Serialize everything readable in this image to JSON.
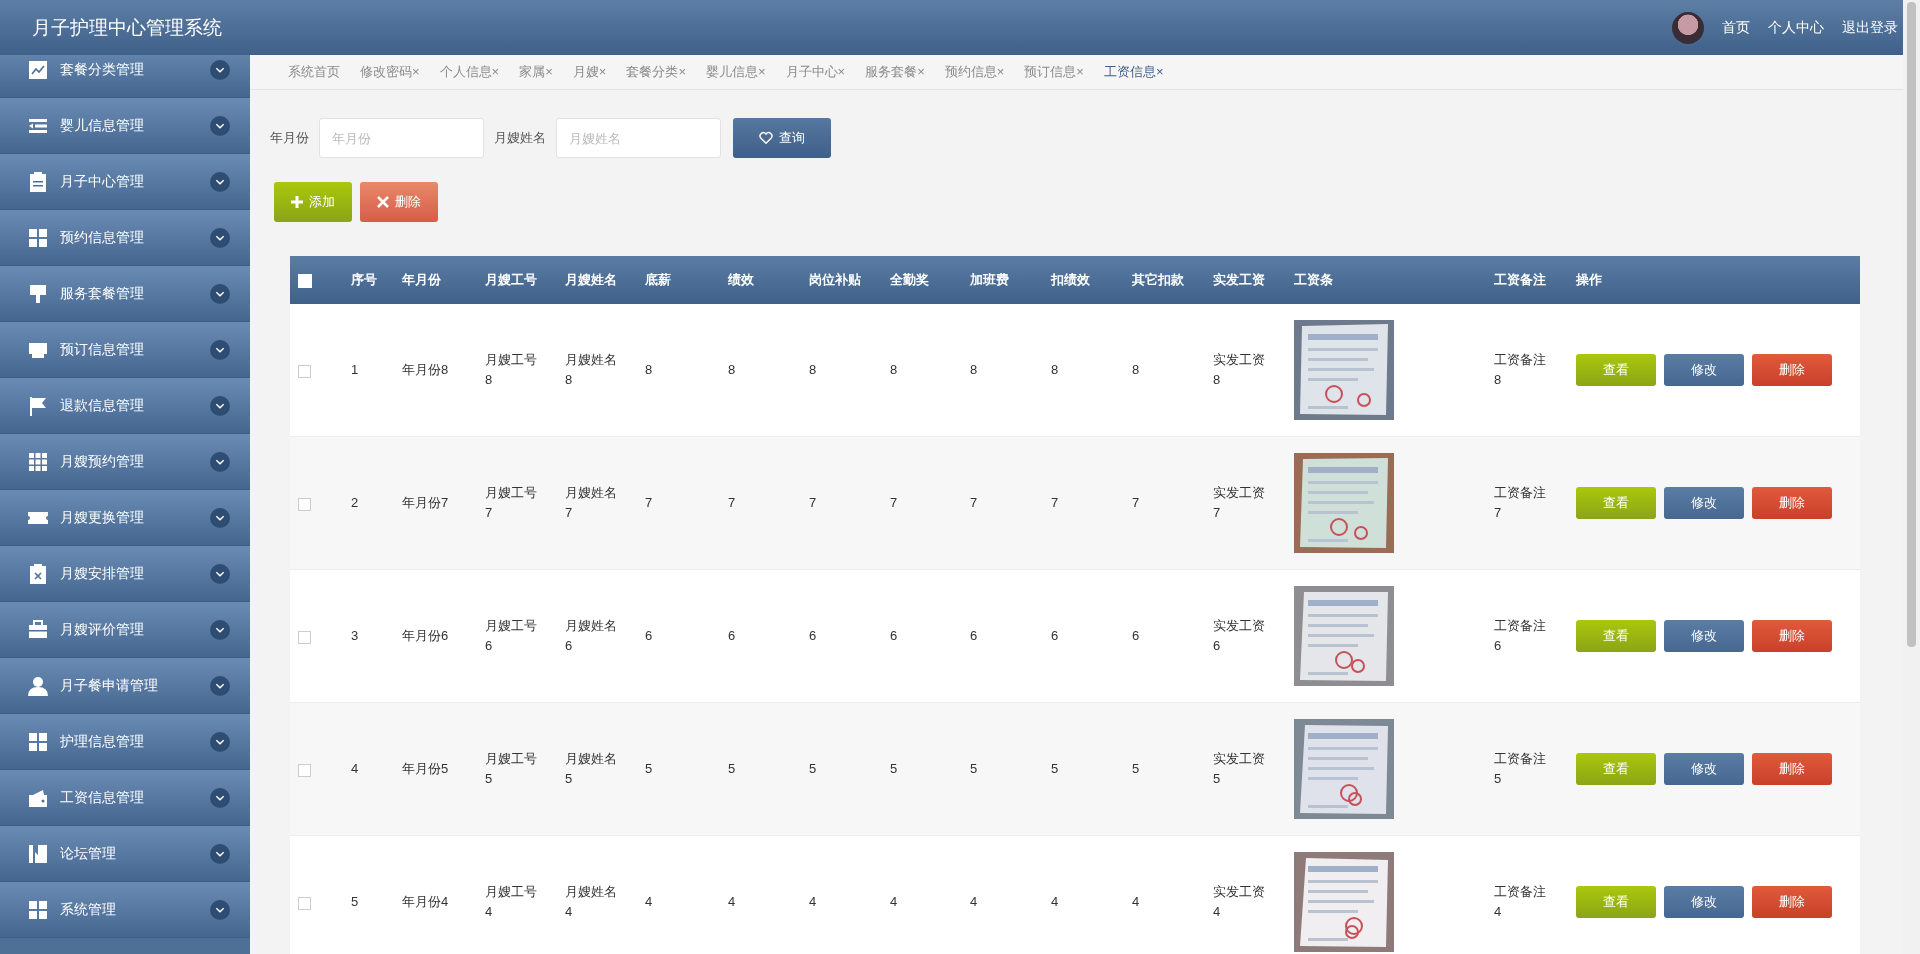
{
  "header": {
    "title": "月子护理中心管理系统",
    "links": [
      "首页",
      "个人中心",
      "退出登录"
    ]
  },
  "sidebar": {
    "items": [
      {
        "label": "套餐分类管理",
        "expanded": false
      },
      {
        "label": "婴儿信息管理",
        "expanded": false
      },
      {
        "label": "月子中心管理",
        "expanded": false
      },
      {
        "label": "预约信息管理",
        "expanded": false
      },
      {
        "label": "服务套餐管理",
        "expanded": false
      },
      {
        "label": "预订信息管理",
        "expanded": false
      },
      {
        "label": "退款信息管理",
        "expanded": false
      },
      {
        "label": "月嫂预约管理",
        "expanded": false
      },
      {
        "label": "月嫂更换管理",
        "expanded": false
      },
      {
        "label": "月嫂安排管理",
        "expanded": false
      },
      {
        "label": "月嫂评价管理",
        "expanded": false
      },
      {
        "label": "月子餐申请管理",
        "expanded": false
      },
      {
        "label": "护理信息管理",
        "expanded": false
      },
      {
        "label": "工资信息管理",
        "expanded": false
      },
      {
        "label": "论坛管理",
        "expanded": false
      },
      {
        "label": "系统管理",
        "expanded": false
      }
    ]
  },
  "tabs": [
    {
      "label": "系统首页",
      "selected": false
    },
    {
      "label": "修改密码",
      "close": "×",
      "selected": false
    },
    {
      "label": "个人信息",
      "close": "×",
      "selected": false
    },
    {
      "label": "家属",
      "close": "×",
      "selected": false
    },
    {
      "label": "月嫂",
      "close": "×",
      "selected": false
    },
    {
      "label": "套餐分类",
      "close": "×",
      "selected": false
    },
    {
      "label": "婴儿信息",
      "close": "×",
      "selected": false
    },
    {
      "label": "月子中心",
      "close": "×",
      "selected": false
    },
    {
      "label": "服务套餐",
      "close": "×",
      "selected": false
    },
    {
      "label": "预约信息",
      "close": "×",
      "selected": false
    },
    {
      "label": "预订信息",
      "close": "×",
      "selected": false
    },
    {
      "label": "工资信息",
      "close": "×",
      "selected": true
    }
  ],
  "search": {
    "fields": [
      {
        "label": "年月份",
        "placeholder": "年月份"
      },
      {
        "label": "月嫂姓名",
        "placeholder": "月嫂姓名"
      }
    ],
    "button": "查询"
  },
  "toolbar": [
    {
      "label": "添加",
      "kind": "add"
    },
    {
      "label": "删除",
      "kind": "delete"
    }
  ],
  "table": {
    "columns": [
      "序号",
      "年月份",
      "月嫂工号",
      "月嫂姓名",
      "底薪",
      "绩效",
      "岗位补贴",
      "全勤奖",
      "加班费",
      "扣绩效",
      "其它扣款",
      "实发工资",
      "工资条",
      "工资备注",
      "操作"
    ],
    "header_checked": false,
    "rows": [
      {
        "checked": false,
        "cells": [
          "1",
          "年月份8",
          "月嫂工号8",
          "月嫂姓名8",
          "8",
          "8",
          "8",
          "8",
          "8",
          "8",
          "8",
          "实发工资8"
        ],
        "note": "工资备注8",
        "actions": [
          {
            "label": "查看",
            "kind": "view"
          },
          {
            "label": "修改",
            "kind": "edit"
          },
          {
            "label": "删除",
            "kind": "delete"
          }
        ]
      },
      {
        "checked": false,
        "cells": [
          "2",
          "年月份7",
          "月嫂工号7",
          "月嫂姓名7",
          "7",
          "7",
          "7",
          "7",
          "7",
          "7",
          "7",
          "实发工资7"
        ],
        "note": "工资备注7",
        "actions": [
          {
            "label": "查看",
            "kind": "view"
          },
          {
            "label": "修改",
            "kind": "edit"
          },
          {
            "label": "删除",
            "kind": "delete"
          }
        ]
      },
      {
        "checked": false,
        "cells": [
          "3",
          "年月份6",
          "月嫂工号6",
          "月嫂姓名6",
          "6",
          "6",
          "6",
          "6",
          "6",
          "6",
          "6",
          "实发工资6"
        ],
        "note": "工资备注6",
        "actions": [
          {
            "label": "查看",
            "kind": "view"
          },
          {
            "label": "修改",
            "kind": "edit"
          },
          {
            "label": "删除",
            "kind": "delete"
          }
        ]
      },
      {
        "checked": false,
        "cells": [
          "4",
          "年月份5",
          "月嫂工号5",
          "月嫂姓名5",
          "5",
          "5",
          "5",
          "5",
          "5",
          "5",
          "5",
          "实发工资5"
        ],
        "note": "工资备注5",
        "actions": [
          {
            "label": "查看",
            "kind": "view"
          },
          {
            "label": "修改",
            "kind": "edit"
          },
          {
            "label": "删除",
            "kind": "delete"
          }
        ]
      },
      {
        "checked": false,
        "cells": [
          "5",
          "年月份4",
          "月嫂工号4",
          "月嫂姓名4",
          "4",
          "4",
          "4",
          "4",
          "4",
          "4",
          "4",
          "实发工资4"
        ],
        "note": "工资备注4",
        "actions": [
          {
            "label": "查看",
            "kind": "view"
          },
          {
            "label": "修改",
            "kind": "edit"
          },
          {
            "label": "删除",
            "kind": "delete"
          }
        ]
      }
    ]
  }
}
